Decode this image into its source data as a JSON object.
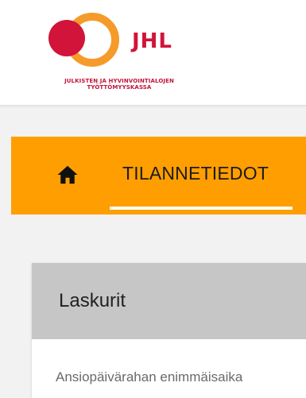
{
  "header": {
    "logo_name": "JHL",
    "logo_tagline_line1": "JULKISTEN JA HYVINVOINTIALOJEN",
    "logo_tagline_line2": "TYÖTTÖMYYSKASSA",
    "colors": {
      "brand_red": "#d2143a",
      "brand_orange": "#ff9e00"
    }
  },
  "nav": {
    "home_icon": "home-icon",
    "tab_label": "TILANNETIEDOT"
  },
  "card": {
    "title": "Laskurit",
    "body_text": "Ansiopäivärahan enimmäisaika"
  }
}
